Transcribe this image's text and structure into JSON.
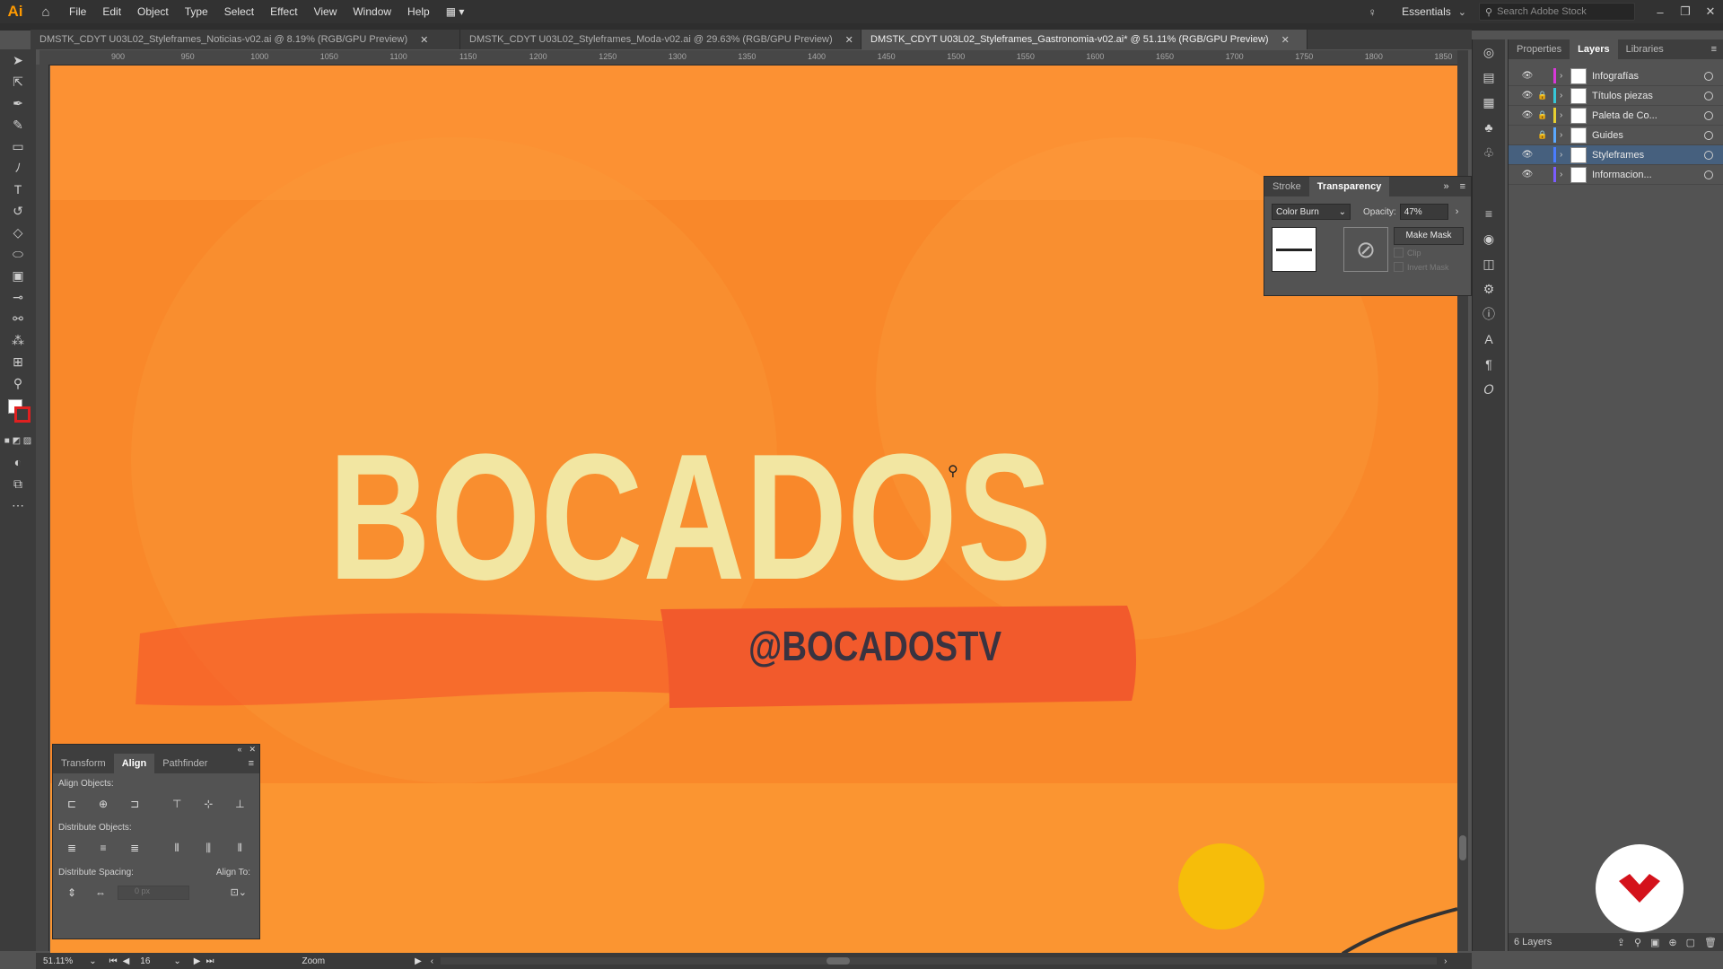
{
  "app": {
    "logo": "Ai"
  },
  "menu": [
    "File",
    "Edit",
    "Object",
    "Type",
    "Select",
    "Effect",
    "View",
    "Window",
    "Help"
  ],
  "workspace": {
    "name": "Essentials",
    "search_placeholder": "Search Adobe Stock"
  },
  "doc_tabs": [
    {
      "label": "DMSTK_CDYT U03L02_Styleframes_Noticias-v02.ai @ 8.19% (RGB/GPU Preview)"
    },
    {
      "label": "DMSTK_CDYT U03L02_Styleframes_Moda-v02.ai @ 29.63% (RGB/GPU Preview)"
    },
    {
      "label": "DMSTK_CDYT U03L02_Styleframes_Gastronomia-v02.ai* @ 51.11% (RGB/GPU Preview)"
    }
  ],
  "ruler": {
    "ticks": [
      "900",
      "950",
      "1000",
      "1050",
      "1100",
      "1150",
      "1200",
      "1250",
      "1300",
      "1350",
      "1400",
      "1450",
      "1500",
      "1550",
      "1600",
      "1650",
      "1700",
      "1750",
      "1800",
      "1850"
    ]
  },
  "artwork": {
    "title": "BOCADOS",
    "handle": "@BOCADOSTV"
  },
  "right_tabs": [
    "Properties",
    "Layers",
    "Libraries"
  ],
  "layers": [
    {
      "name": "Infografías",
      "color": "#d838d8",
      "visible": true,
      "locked": false
    },
    {
      "name": "Títulos piezas",
      "color": "#36c8d8",
      "visible": true,
      "locked": true
    },
    {
      "name": "Paleta de Co...",
      "color": "#e8d030",
      "visible": true,
      "locked": true
    },
    {
      "name": "Guides",
      "color": "#5aa8ff",
      "visible": false,
      "locked": true
    },
    {
      "name": "Styleframes",
      "color": "#4a7cff",
      "visible": true,
      "locked": false,
      "selected": true
    },
    {
      "name": "Informacion...",
      "color": "#7a5cff",
      "visible": true,
      "locked": false
    }
  ],
  "layers_footer": {
    "count": "6 Layers"
  },
  "transparency": {
    "tabs": [
      "Stroke",
      "Transparency"
    ],
    "blend_mode": "Color Burn",
    "opacity_label": "Opacity:",
    "opacity_value": "47%",
    "make_mask": "Make Mask",
    "clip": "Clip",
    "invert_mask": "Invert Mask"
  },
  "align": {
    "tabs": [
      "Transform",
      "Align",
      "Pathfinder"
    ],
    "align_objects": "Align Objects:",
    "distribute_objects": "Distribute Objects:",
    "distribute_spacing": "Distribute Spacing:",
    "align_to": "Align To:",
    "spacing_value": "0 px"
  },
  "status": {
    "zoom": "51.11%",
    "artboard": "16",
    "tool": "Zoom"
  }
}
